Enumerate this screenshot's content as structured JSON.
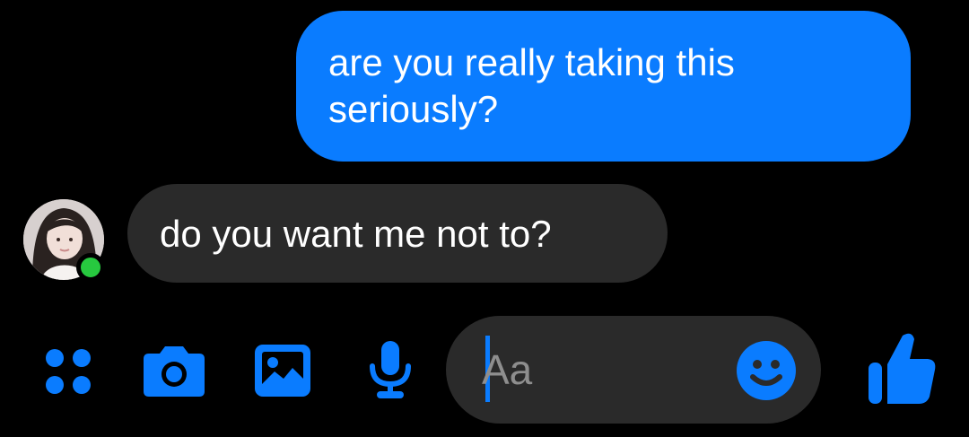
{
  "conversation": {
    "messages": [
      {
        "direction": "outgoing",
        "text": "are you really taking this seriously?"
      },
      {
        "direction": "incoming",
        "text": "do you want me not to?"
      }
    ],
    "contact": {
      "online": true
    }
  },
  "composer": {
    "placeholder": "Aa",
    "toolbar_icons": [
      "apps-grid-icon",
      "camera-icon",
      "gallery-icon",
      "microphone-icon"
    ],
    "emoji_icon": "smiley-icon",
    "send_icon": "thumbs-up-icon"
  },
  "colors": {
    "accent": "#0a7cff",
    "outgoing_bubble": "#0a7cff",
    "incoming_bubble": "#2a2a2a",
    "background": "#000000",
    "online": "#27c93f"
  }
}
